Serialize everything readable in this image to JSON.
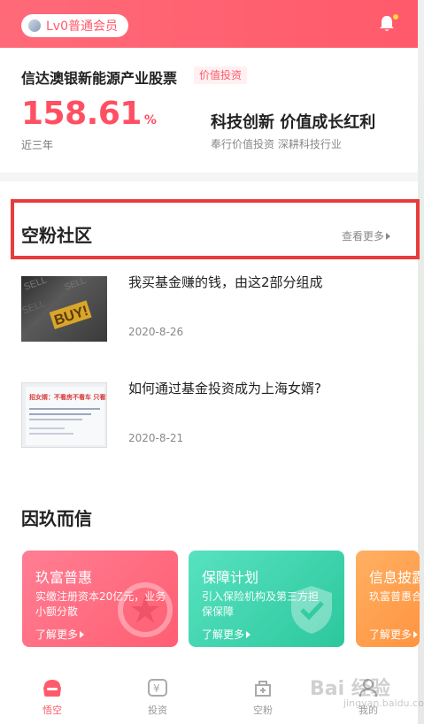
{
  "header": {
    "member_level": "Lv0普通会员",
    "accent": "#ff5a6b"
  },
  "fund": {
    "name": "信达澳银新能源产业股票",
    "tag": "价值投资",
    "return_value": "158.61",
    "return_unit": "%",
    "period": "近三年",
    "slogan": "科技创新 价值成长红利",
    "slogan_sub": "奉行价值投资 深耕科技行业"
  },
  "community": {
    "title": "空粉社区",
    "more": "查看更多",
    "articles": [
      {
        "title": "我买基金赚的钱，由这2部分组成",
        "date": "2020-8-26",
        "thumb_text": "BUY!"
      },
      {
        "title": "如何通过基金投资成为上海女婿?",
        "date": "2020-8-21",
        "thumb_text": "招女婿：不看房不看车 只看理财水平高"
      }
    ]
  },
  "trust": {
    "title": "因玖而信",
    "cards": [
      {
        "title": "玖富普惠",
        "desc": "实缴注册资本20亿元，业务\n小额分散",
        "more": "了解更多"
      },
      {
        "title": "保障计划",
        "desc": "引入保险机构及第三方担\n保保障",
        "more": "了解更多"
      },
      {
        "title": "信息披露",
        "desc": "玖富普惠合",
        "more": "了解更多"
      }
    ]
  },
  "tabbar": {
    "tabs": [
      {
        "label": "悟空",
        "icon": "wukong-icon"
      },
      {
        "label": "投资",
        "icon": "invest-icon"
      },
      {
        "label": "空粉",
        "icon": "community-icon"
      },
      {
        "label": "我的",
        "icon": "profile-icon"
      }
    ],
    "active_index": 0
  },
  "watermark": {
    "brand": "Bai 经验",
    "url": "jingyan.baidu.com"
  }
}
